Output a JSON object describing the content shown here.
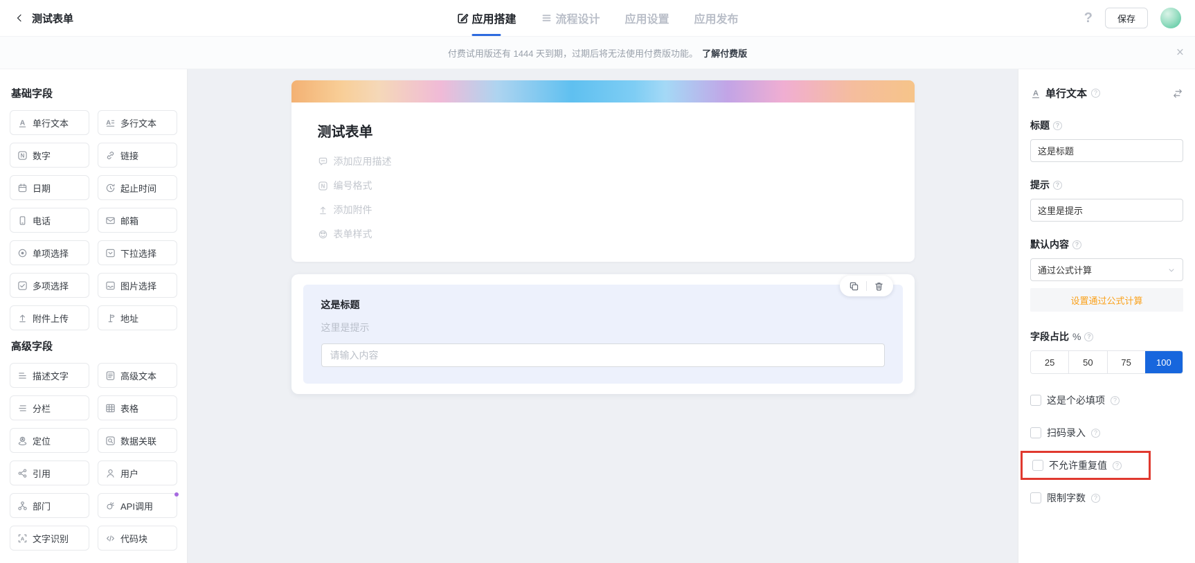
{
  "header": {
    "title": "测试表单",
    "tabs": [
      {
        "label": "应用搭建",
        "active": true
      },
      {
        "label": "流程设计",
        "active": false
      },
      {
        "label": "应用设置",
        "active": false
      },
      {
        "label": "应用发布",
        "active": false
      }
    ],
    "save_label": "保存"
  },
  "glyphs": {
    "help": "?",
    "close": "×"
  },
  "notice": {
    "text": "付费试用版还有 1444 天到期，过期后将无法使用付费版功能。",
    "link_label": "了解付费版"
  },
  "sidebar": {
    "sections": [
      {
        "title": "基础字段",
        "items": [
          {
            "label": "单行文本",
            "icon": "single-line-text"
          },
          {
            "label": "多行文本",
            "icon": "multi-line-text"
          },
          {
            "label": "数字",
            "icon": "number"
          },
          {
            "label": "链接",
            "icon": "link"
          },
          {
            "label": "日期",
            "icon": "date"
          },
          {
            "label": "起止时间",
            "icon": "time-range"
          },
          {
            "label": "电话",
            "icon": "phone"
          },
          {
            "label": "邮箱",
            "icon": "email"
          },
          {
            "label": "单项选择",
            "icon": "radio"
          },
          {
            "label": "下拉选择",
            "icon": "dropdown"
          },
          {
            "label": "多项选择",
            "icon": "checkbox"
          },
          {
            "label": "图片选择",
            "icon": "image"
          },
          {
            "label": "附件上传",
            "icon": "upload"
          },
          {
            "label": "地址",
            "icon": "address"
          }
        ]
      },
      {
        "title": "高级字段",
        "items": [
          {
            "label": "描述文字",
            "icon": "description"
          },
          {
            "label": "高级文本",
            "icon": "rich-text"
          },
          {
            "label": "分栏",
            "icon": "columns"
          },
          {
            "label": "表格",
            "icon": "table"
          },
          {
            "label": "定位",
            "icon": "location"
          },
          {
            "label": "数据关联",
            "icon": "data-link"
          },
          {
            "label": "引用",
            "icon": "reference"
          },
          {
            "label": "用户",
            "icon": "user"
          },
          {
            "label": "部门",
            "icon": "department"
          },
          {
            "label": "API调用",
            "icon": "api"
          },
          {
            "label": "文字识别",
            "icon": "ocr"
          },
          {
            "label": "代码块",
            "icon": "code"
          }
        ]
      }
    ]
  },
  "canvas": {
    "form_title": "测试表单",
    "options": [
      {
        "label": "添加应用描述",
        "icon": "comment"
      },
      {
        "label": "编号格式",
        "icon": "number"
      },
      {
        "label": "添加附件",
        "icon": "upload"
      },
      {
        "label": "表单样式",
        "icon": "style"
      }
    ],
    "field": {
      "title": "这是标题",
      "hint": "这里是提示",
      "placeholder": "请输入内容"
    }
  },
  "panel": {
    "type_label": "单行文本",
    "title_label": "标题",
    "title_value": "这是标题",
    "hint_label": "提示",
    "hint_value": "这里是提示",
    "default_label": "默认内容",
    "default_value": "通过公式计算",
    "formula_link": "设置通过公式计算",
    "width_label": "字段占比",
    "width_unit": "%",
    "width_options": [
      "25",
      "50",
      "75",
      "100"
    ],
    "width_selected": "100",
    "checkboxes": [
      {
        "label": "这是个必填项",
        "checked": false,
        "highlighted": false
      },
      {
        "label": "扫码录入",
        "checked": false,
        "highlighted": false
      },
      {
        "label": "不允许重复值",
        "checked": false,
        "highlighted": true
      },
      {
        "label": "限制字数",
        "checked": false,
        "highlighted": false
      }
    ]
  },
  "colors": {
    "accent_blue": "#2e6bdf",
    "selected_blue": "#1766dd",
    "orange_link": "#faa21d",
    "highlight_red": "#e0392f",
    "selected_field_bg": "#edf1fc"
  }
}
